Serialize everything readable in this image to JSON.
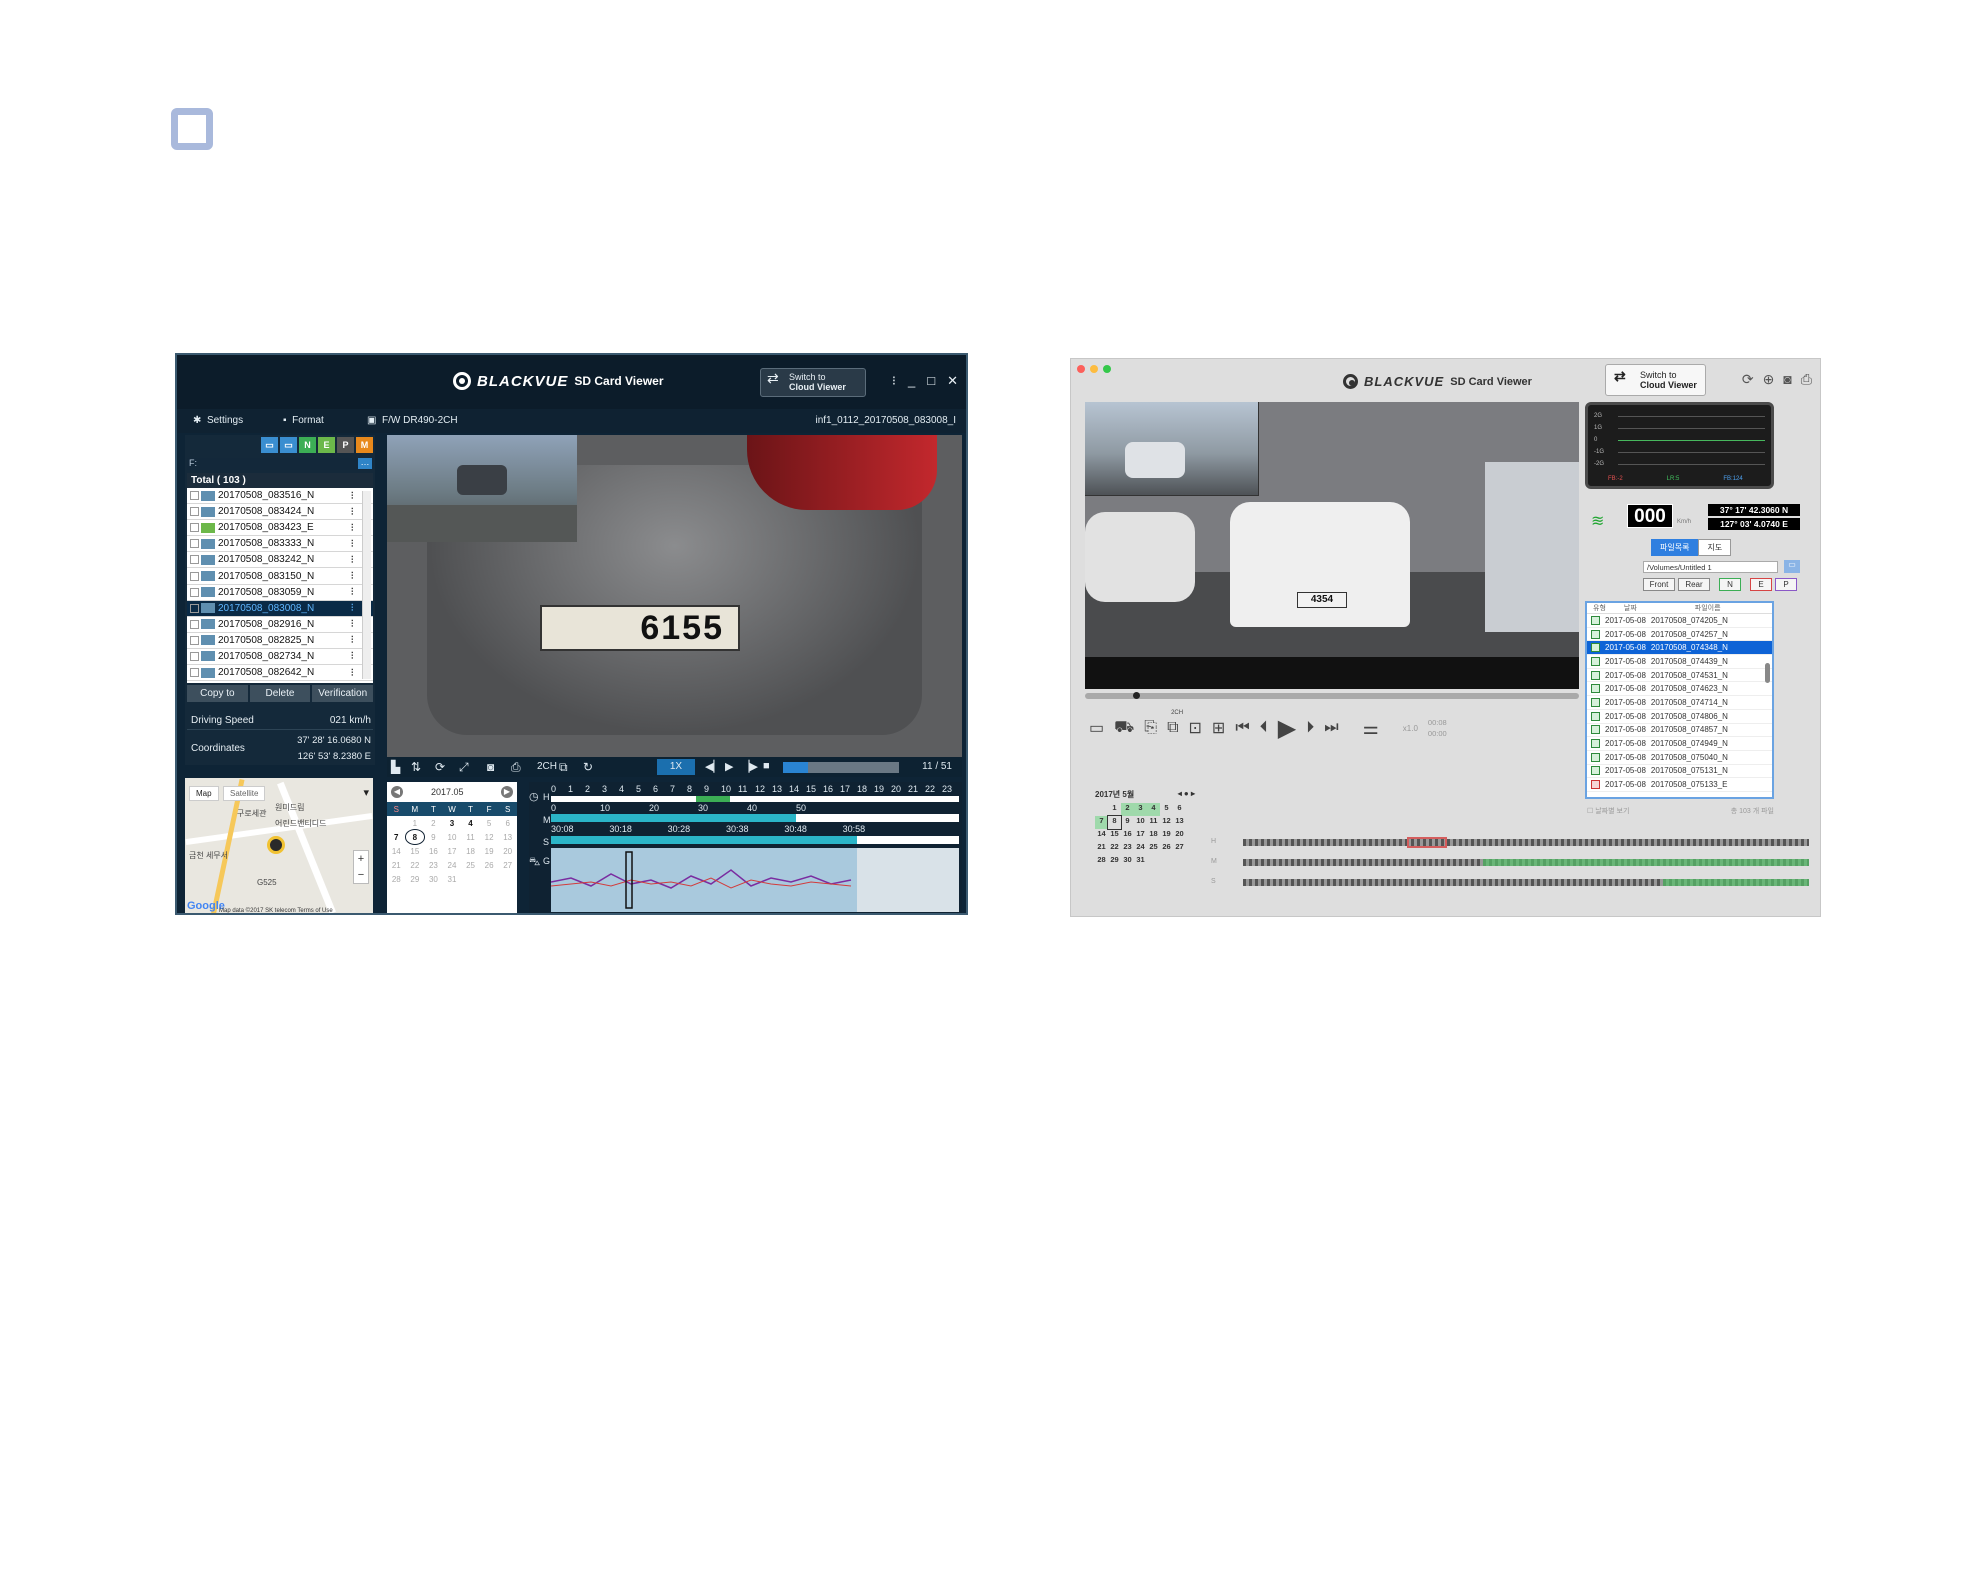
{
  "win": {
    "brand": "BLACKVUE",
    "product": "SD Card Viewer",
    "switch_line1": "Switch to",
    "switch_line2": "Cloud Viewer",
    "menu_settings": "Settings",
    "menu_format": "Format",
    "fw": "F/W DR490-2CH",
    "current_file": "inf1_0112_20170508_083008_I",
    "drive": "F:",
    "badges": [
      "N",
      "E",
      "P",
      "M"
    ],
    "total": "Total ( 103 )",
    "files": [
      "20170508_083516_N",
      "20170508_083424_N",
      "20170508_083423_E",
      "20170508_083333_N",
      "20170508_083242_N",
      "20170508_083150_N",
      "20170508_083059_N",
      "20170508_083008_N",
      "20170508_082916_N",
      "20170508_082825_N",
      "20170508_082734_N",
      "20170508_082642_N"
    ],
    "btn_copy": "Copy to",
    "btn_delete": "Delete",
    "btn_verify": "Verification",
    "driving_speed_label": "Driving Speed",
    "driving_speed": "021 km/h",
    "coord_label": "Coordinates",
    "lat": "37' 28' 16.0680 N",
    "lon": "126' 53' 8.2380 E",
    "map_tab_map": "Map",
    "map_tab_sat": "Satellite",
    "map_label1": "구로세관",
    "map_label2": "원미드림",
    "map_label3": "어린드밴티디드",
    "map_label4": "금천 세무서",
    "map_label5": "G525",
    "map_google": "Google",
    "map_footer": "Map data ©2017 SK telecom  Terms of Use",
    "plate": "6155",
    "speed_btn": "1X",
    "ch": "2CH",
    "counter": "11 / 51",
    "cal_month": "2017.05",
    "cal_days": [
      "S",
      "M",
      "T",
      "W",
      "T",
      "F",
      "S"
    ],
    "cal_rows": [
      [
        "",
        "1",
        "2",
        "3",
        "4",
        "5",
        "6"
      ],
      [
        "7",
        "8",
        "9",
        "10",
        "11",
        "12",
        "13"
      ],
      [
        "14",
        "15",
        "16",
        "17",
        "18",
        "19",
        "20"
      ],
      [
        "21",
        "22",
        "23",
        "24",
        "25",
        "26",
        "27"
      ],
      [
        "28",
        "29",
        "30",
        "31",
        "",
        "",
        ""
      ]
    ],
    "tl_h": "H",
    "tl_m": "M",
    "tl_s": "S",
    "tl_g": "G",
    "tl_hours": [
      "0",
      "1",
      "2",
      "3",
      "4",
      "5",
      "6",
      "7",
      "8",
      "9",
      "10",
      "11",
      "12",
      "13",
      "14",
      "15",
      "16",
      "17",
      "18",
      "19",
      "20",
      "21",
      "22",
      "23"
    ],
    "tl_minutes": [
      "0",
      "10",
      "20",
      "30",
      "40",
      "50"
    ],
    "tl_seconds": [
      "30:08",
      "30:18",
      "30:28",
      "30:38",
      "30:48",
      "30:58"
    ]
  },
  "mac": {
    "brand": "BLACKVUE",
    "product": "SD Card Viewer",
    "switch_line1": "Switch to",
    "switch_line2": "Cloud Viewer",
    "g_labels": [
      "2G",
      "1G",
      "0",
      "-1G",
      "-2G"
    ],
    "g_legend": [
      "FB:-2",
      "LR:5",
      "FB:124"
    ],
    "speed_value": "000",
    "speed_unit": "Km/h",
    "lat": "37° 17' 42.3060 N",
    "lon": "127° 03' 4.0740 E",
    "tab_files": "파일목록",
    "tab_map": "지도",
    "folder": "/Volumes/Untitled 1",
    "btn_front": "Front",
    "btn_rear": "Rear",
    "btn_n": "N",
    "btn_e": "E",
    "btn_p": "P",
    "list_headers": [
      "유형",
      "날짜",
      "파일이름"
    ],
    "rows": [
      [
        "2017-05-08",
        "20170508_074205_N"
      ],
      [
        "2017-05-08",
        "20170508_074257_N"
      ],
      [
        "2017-05-08",
        "20170508_074348_N"
      ],
      [
        "2017-05-08",
        "20170508_074439_N"
      ],
      [
        "2017-05-08",
        "20170508_074531_N"
      ],
      [
        "2017-05-08",
        "20170508_074623_N"
      ],
      [
        "2017-05-08",
        "20170508_074714_N"
      ],
      [
        "2017-05-08",
        "20170508_074806_N"
      ],
      [
        "2017-05-08",
        "20170508_074857_N"
      ],
      [
        "2017-05-08",
        "20170508_074949_N"
      ],
      [
        "2017-05-08",
        "20170508_075040_N"
      ],
      [
        "2017-05-08",
        "20170508_075131_N"
      ],
      [
        "2017-05-08",
        "20170508_075133_E"
      ]
    ],
    "list_footer_left": "날짜별 보기",
    "list_footer_right": "총 103 개 파일",
    "plate": "4354",
    "rate": "x1.0",
    "time1": "00:08",
    "time2": "00:00",
    "ch": "2CH",
    "cal_title": "2017년 5월",
    "cal_rows": [
      [
        "",
        "1",
        "2",
        "3",
        "4",
        "5",
        "6"
      ],
      [
        "7",
        "8",
        "9",
        "10",
        "11",
        "12",
        "13"
      ],
      [
        "14",
        "15",
        "16",
        "17",
        "18",
        "19",
        "20"
      ],
      [
        "21",
        "22",
        "23",
        "24",
        "25",
        "26",
        "27"
      ],
      [
        "28",
        "29",
        "30",
        "31",
        "",
        "",
        ""
      ]
    ]
  }
}
